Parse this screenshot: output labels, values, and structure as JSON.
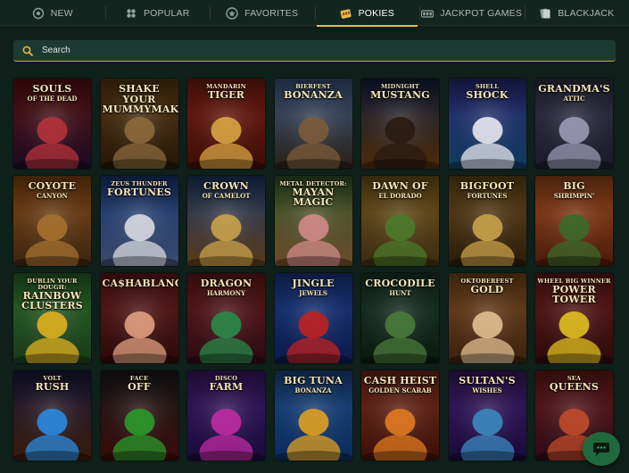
{
  "tabs": [
    {
      "label": "NEW",
      "icon": "sparkle-icon",
      "active": false
    },
    {
      "label": "POPULAR",
      "icon": "flower-icon",
      "active": false
    },
    {
      "label": "FAVORITES",
      "icon": "star-badge-icon",
      "active": false
    },
    {
      "label": "POKIES",
      "icon": "slot-machine-icon",
      "active": true
    },
    {
      "label": "JACKPOT GAMES",
      "icon": "jackpot-icon",
      "active": false
    },
    {
      "label": "BLACKJACK",
      "icon": "cards-icon",
      "active": false
    }
  ],
  "search": {
    "placeholder": "Search",
    "icon": "search-icon"
  },
  "colors": {
    "background": "#0f1f1a",
    "accent": "#e6b94c",
    "search_bg": "#1d3a32"
  },
  "games": [
    {
      "pre": "",
      "main": "SOULS",
      "sub": "OF THE DEAD",
      "c1": "#5c1010",
      "c2": "#1b0b24",
      "fig": "#b5323a"
    },
    {
      "pre": "",
      "main": "SHAKE YOUR MUMMYMAKER",
      "sub": "",
      "c1": "#5c3a12",
      "c2": "#241607",
      "fig": "#8a6a3c"
    },
    {
      "pre": "MANDARIN",
      "main": "TIGER",
      "sub": "",
      "c1": "#7a1d10",
      "c2": "#3b0d07",
      "fig": "#d9a441"
    },
    {
      "pre": "BIERFEST",
      "main": "BONANZA",
      "sub": "",
      "c1": "#3d5a86",
      "c2": "#2a1f14",
      "fig": "#7c5b3a"
    },
    {
      "pre": "MIDNIGHT",
      "main": "MUSTANG",
      "sub": "",
      "c1": "#15213f",
      "c2": "#4d2a07",
      "fig": "#2a1a10"
    },
    {
      "pre": "SHELL",
      "main": "SHOCK",
      "sub": "",
      "c1": "#2a2a7a",
      "c2": "#0f3b5c",
      "fig": "#e8e8f0"
    },
    {
      "pre": "",
      "main": "GRANDMA'S",
      "sub": "ATTIC",
      "c1": "#31334a",
      "c2": "#191b2a",
      "fig": "#9a9ab5"
    },
    {
      "pre": "",
      "main": "COYOTE",
      "sub": "CANYON",
      "c1": "#8a4a12",
      "c2": "#3a2410",
      "fig": "#a6702e"
    },
    {
      "pre": "ZEUS THUNDER",
      "main": "FORTUNES",
      "sub": "",
      "c1": "#1a3a7a",
      "c2": "#3a4a6a",
      "fig": "#d9d9e0"
    },
    {
      "pre": "",
      "main": "CROWN",
      "sub": "OF CAMELOT",
      "c1": "#1f3a6a",
      "c2": "#5a3a1a",
      "fig": "#c9a24a"
    },
    {
      "pre": "METAL DETECTOR:",
      "main": "MAYAN MAGIC",
      "sub": "",
      "c1": "#3a5a2a",
      "c2": "#6a4a2a",
      "fig": "#d08a8a"
    },
    {
      "pre": "",
      "main": "DAWN OF",
      "sub": "EL DORADO",
      "c1": "#7a5a1a",
      "c2": "#3a2a10",
      "fig": "#4a7a2a"
    },
    {
      "pre": "",
      "main": "BIGFOOT",
      "sub": "FORTUNES",
      "c1": "#6a4a1a",
      "c2": "#2a1a0a",
      "fig": "#c9a24a"
    },
    {
      "pre": "",
      "main": "BIG",
      "sub": "SHRIMPIN'",
      "c1": "#a04a1a",
      "c2": "#4a1a0a",
      "fig": "#3a6a2a"
    },
    {
      "pre": "DUBLIN YOUR DOUGH:",
      "main": "RAINBOW CLUSTERS",
      "sub": "",
      "c1": "#2a6a2a",
      "c2": "#1a3a1a",
      "fig": "#e0b020"
    },
    {
      "pre": "",
      "main": "CA$HABLANCA",
      "sub": "",
      "c1": "#6a1a1a",
      "c2": "#2a0a0a",
      "fig": "#e0a080"
    },
    {
      "pre": "",
      "main": "DRAGON",
      "sub": "HARMONY",
      "c1": "#6a1a1a",
      "c2": "#2a0a14",
      "fig": "#2a8a4a"
    },
    {
      "pre": "",
      "main": "JINGLE",
      "sub": "JEWELS",
      "c1": "#1a3a8a",
      "c2": "#0a1a4a",
      "fig": "#c02020"
    },
    {
      "pre": "",
      "main": "CROCODILE",
      "sub": "HUNT",
      "c1": "#1a3a2a",
      "c2": "#0a1a10",
      "fig": "#4a7a3a"
    },
    {
      "pre": "OKTOBERFEST",
      "main": "GOLD",
      "sub": "",
      "c1": "#7a4a1a",
      "c2": "#3a2010",
      "fig": "#e0c090"
    },
    {
      "pre": "WHEEL BIG WINNER",
      "main": "POWER TOWER",
      "sub": "",
      "c1": "#6a1a1a",
      "c2": "#2a0a0a",
      "fig": "#e0c020"
    },
    {
      "pre": "VOLT",
      "main": "RUSH",
      "sub": "",
      "c1": "#1a1a3a",
      "c2": "#3a1a0a",
      "fig": "#2a8ae0"
    },
    {
      "pre": "FACE",
      "main": "OFF",
      "sub": "",
      "c1": "#1a1a1a",
      "c2": "#3a0a0a",
      "fig": "#2a9a2a"
    },
    {
      "pre": "DISCO",
      "main": "FARM",
      "sub": "",
      "c1": "#3a1a6a",
      "c2": "#1a0a3a",
      "fig": "#c02aa0"
    },
    {
      "pre": "",
      "main": "BIG TUNA",
      "sub": "BONANZA",
      "c1": "#1a4a8a",
      "c2": "#0a2a5a",
      "fig": "#e0a020"
    },
    {
      "pre": "",
      "main": "CASH HEIST",
      "sub": "GOLDEN SCARAB",
      "c1": "#7a2a1a",
      "c2": "#3a1008",
      "fig": "#e07a20"
    },
    {
      "pre": "",
      "main": "SULTAN'S",
      "sub": "WISHES",
      "c1": "#3a1a6a",
      "c2": "#1a0a3a",
      "fig": "#3a8ac0"
    },
    {
      "pre": "SEA",
      "main": "QUEENS",
      "sub": "",
      "c1": "#6a1a1a",
      "c2": "#2a0a1a",
      "fig": "#c04a2a"
    }
  ],
  "chat": {
    "icon": "chat-icon"
  }
}
